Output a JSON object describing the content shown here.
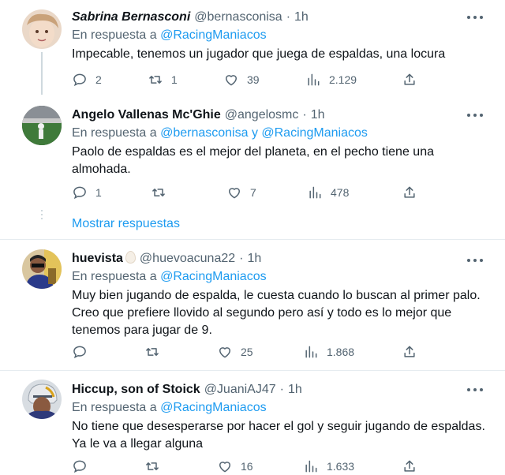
{
  "reply_prefix": "En respuesta a",
  "tweets": [
    {
      "name": "Sabrina Bernasconi",
      "handle": "@bernasconisa",
      "separator": "·",
      "time": "1h",
      "reply_to": "@RacingManiacos",
      "text": "Impecable, tenemos un jugador que juega de espaldas, una locura",
      "replies": "2",
      "retweets": "1",
      "likes": "39",
      "views": "2.129"
    },
    {
      "name": "Angelo Vallenas Mc'Ghie",
      "handle": "@angelosmc",
      "separator": "·",
      "time": "1h",
      "reply_to": "@bernasconisa y @RacingManiacos",
      "text": "Paolo de espaldas es el mejor del planeta, en el pecho tiene una almohada.",
      "replies": "1",
      "retweets": "",
      "likes": "7",
      "views": "478"
    },
    {
      "name": "huevista",
      "handle": "@huevoacuna22",
      "separator": "·",
      "time": "1h",
      "reply_to": "@RacingManiacos",
      "text": "Muy bien jugando de espalda, le cuesta cuando lo buscan al primer palo. Creo que prefiere llovido al segundo pero así y todo es lo mejor que tenemos para jugar de 9.",
      "replies": "",
      "retweets": "",
      "likes": "25",
      "views": "1.868"
    },
    {
      "name": "Hiccup, son of Stoick",
      "handle": "@JuaniAJ47",
      "separator": "·",
      "time": "1h",
      "reply_to": "@RacingManiacos",
      "text": "No tiene que desesperarse por hacer el gol y seguir jugando de espaldas. Ya le va a llegar alguna",
      "replies": "",
      "retweets": "",
      "likes": "16",
      "views": "1.633"
    }
  ],
  "show_replies_label": "Mostrar respuestas",
  "colors": {
    "link": "#1d9bf0",
    "muted": "#536471",
    "text": "#0f1419"
  },
  "icons": [
    "reply-icon",
    "retweet-icon",
    "like-icon",
    "views-icon",
    "share-icon",
    "more-icon"
  ]
}
